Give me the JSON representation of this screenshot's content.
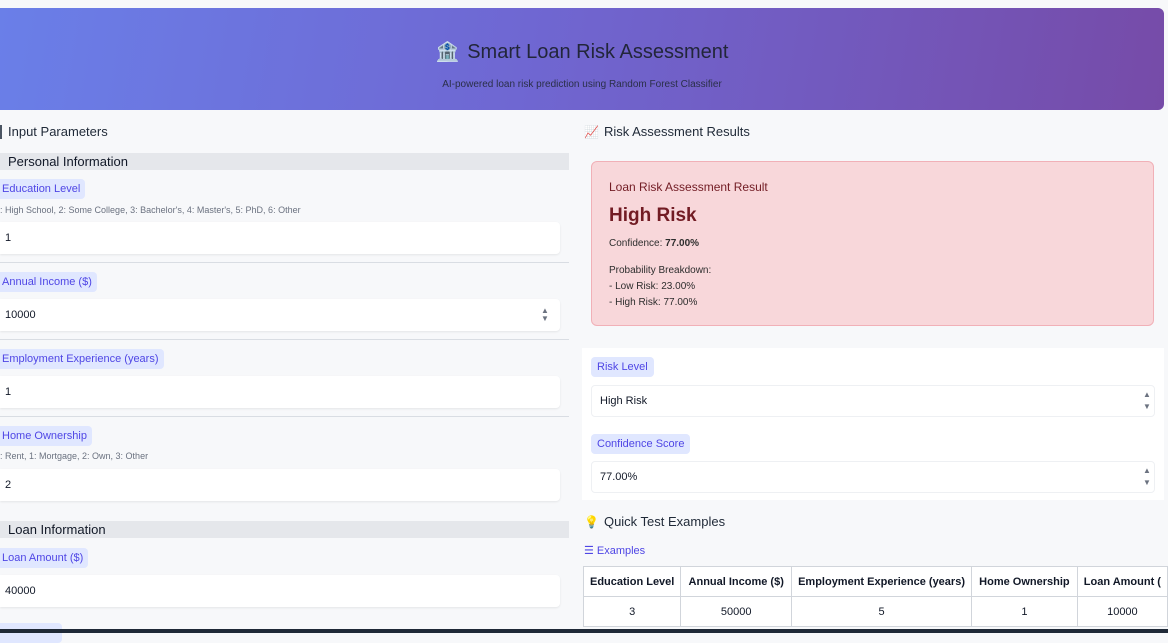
{
  "header": {
    "icon": "bank-icon",
    "title": "Smart Loan Risk Assessment",
    "subtitle": "AI-powered loan risk prediction using Random Forest Classifier"
  },
  "left": {
    "title": "Input Parameters",
    "personal_section": "Personal Information",
    "loan_section": "Loan Information",
    "education": {
      "label": "Education Level",
      "hint": ": High School, 2: Some College, 3: Bachelor's, 4: Master's, 5: PhD, 6: Other",
      "value": "1"
    },
    "income": {
      "label": "Annual Income ($)",
      "value": "10000"
    },
    "experience": {
      "label": "Employment Experience (years)",
      "value": "1"
    },
    "home": {
      "label": "Home Ownership",
      "hint": ": Rent, 1: Mortgage, 2: Own, 3: Other",
      "value": "2"
    },
    "loan_amount": {
      "label": "Loan Amount ($)",
      "value": "40000"
    }
  },
  "right": {
    "title_icon": "chart-increasing-icon",
    "title": "Risk Assessment Results",
    "result": {
      "heading": "Loan Risk Assessment Result",
      "risk": "High Risk",
      "confidence_label": "Confidence:",
      "confidence_value": "77.00%",
      "breakdown_title": "Probability Breakdown:",
      "low_line": "- Low Risk: 23.00%",
      "high_line": "- High Risk: 77.00%"
    },
    "risk_level": {
      "label": "Risk Level",
      "value": "High Risk"
    },
    "confidence_score": {
      "label": "Confidence Score",
      "value": "77.00%"
    },
    "quick_title_icon": "light-bulb-icon",
    "quick_title": "Quick Test Examples",
    "examples_label": "Examples",
    "table": {
      "headers": [
        "Education Level",
        "Annual Income ($)",
        "Employment Experience (years)",
        "Home Ownership",
        "Loan Amount ("
      ],
      "rows": [
        [
          "3",
          "50000",
          "5",
          "1",
          "10000"
        ]
      ]
    }
  },
  "colors": {
    "header_gradient_start": "#6a7fe8",
    "header_gradient_end": "#764ba8",
    "label_bg": "#e0e7ff",
    "label_text": "#4f46e5",
    "danger_bg": "#f8d7da",
    "danger_text": "#721c24"
  }
}
